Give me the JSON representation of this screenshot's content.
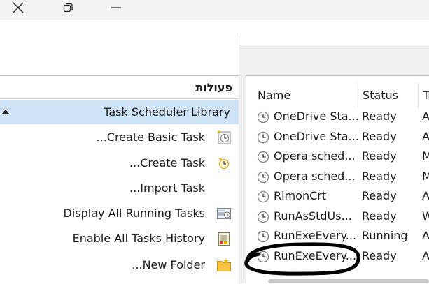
{
  "window": {
    "close_icon": "close-icon",
    "restore_icon": "restore-icon",
    "minimize_icon": "minimize-icon"
  },
  "actions": {
    "title": "פעולות",
    "library": "Task Scheduler Library",
    "items": [
      {
        "label": "...Create Basic Task",
        "icon": "wizard-icon"
      },
      {
        "label": "...Create Task",
        "icon": "task-clock-icon"
      },
      {
        "label": "...Import Task",
        "icon": ""
      },
      {
        "label": "Display All Running Tasks",
        "icon": "running-tasks-icon"
      },
      {
        "label": "Enable All Tasks History",
        "icon": "history-icon"
      },
      {
        "label": "...New Folder",
        "icon": "folder-icon"
      }
    ]
  },
  "tasks": {
    "columns": [
      "Name",
      "Status",
      "Tr"
    ],
    "rows": [
      {
        "name": "OneDrive Sta...",
        "status": "Ready",
        "trigger": "A"
      },
      {
        "name": "OneDrive Sta...",
        "status": "Ready",
        "trigger": "A"
      },
      {
        "name": "Opera sched...",
        "status": "Ready",
        "trigger": "M"
      },
      {
        "name": "Opera sched...",
        "status": "Ready",
        "trigger": "M"
      },
      {
        "name": "RimonCrt",
        "status": "Ready",
        "trigger": "A"
      },
      {
        "name": "RunAsStdUs...",
        "status": "Ready",
        "trigger": "W"
      },
      {
        "name": "RunExeEvery...",
        "status": "Running",
        "trigger": "A"
      },
      {
        "name": "RunExeEvery...",
        "status": "Ready",
        "trigger": "A"
      }
    ]
  },
  "colors": {
    "selection": "#cfe3f7",
    "annotation": "#000000"
  }
}
